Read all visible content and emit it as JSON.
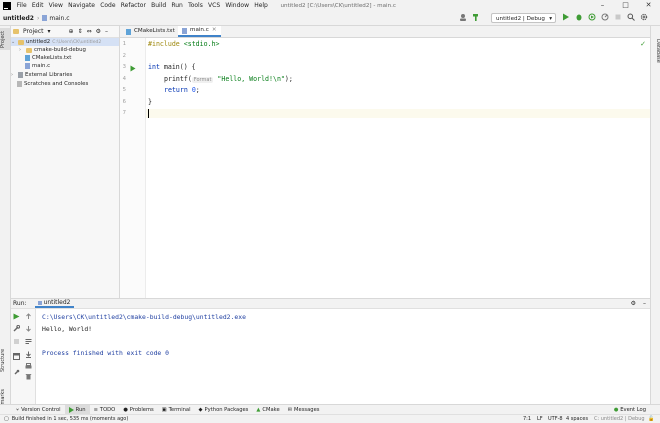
{
  "menubar": {
    "items": [
      "File",
      "Edit",
      "View",
      "Navigate",
      "Code",
      "Refactor",
      "Build",
      "Run",
      "Tools",
      "VCS",
      "Window",
      "Help"
    ],
    "window_title": "untitled2 [C:\\Users\\CK\\untitled2] - main.c"
  },
  "navbar": {
    "project": "untitled2",
    "file": "main.c",
    "run_config": "untitled2 | Debug"
  },
  "side_tabs": {
    "project": "Project",
    "structure": "Structure",
    "bookmarks": "Bookmarks",
    "database": "Database"
  },
  "project_panel": {
    "title": "Project",
    "tree": [
      {
        "label": "untitled2",
        "hint": "C:\\Users\\CK\\untitled2"
      },
      {
        "label": "cmake-build-debug"
      },
      {
        "label": "CMakeLists.txt"
      },
      {
        "label": "main.c"
      },
      {
        "label": "External Libraries"
      },
      {
        "label": "Scratches and Consoles"
      }
    ]
  },
  "editor": {
    "tabs": [
      "CMakeLists.txt",
      "main.c"
    ],
    "line_numbers": [
      "1",
      "2",
      "3",
      "4",
      "5",
      "6",
      "7"
    ],
    "code": {
      "l1_directive": "#include",
      "l1_header": "<stdio.h>",
      "l3_type": "int",
      "l3_rest": " main() {",
      "l4_call": "printf(",
      "l4_hint": "Format",
      "l4_string": "\"Hello, World!\\n\"",
      "l4_end": ");",
      "l5_kw": "return",
      "l5_num": "0",
      "l5_end": ";",
      "l6": "}"
    }
  },
  "run_panel": {
    "label": "Run:",
    "tab": "untitled2",
    "output": [
      "C:\\Users\\CK\\untitled2\\cmake-build-debug\\untitled2.exe",
      "Hello, World!",
      "",
      "Process finished with exit code 0"
    ]
  },
  "tool_windows": [
    "Version Control",
    "Run",
    "TODO",
    "Problems",
    "Terminal",
    "Python Packages",
    "CMake",
    "Messages"
  ],
  "event_log": "Event Log",
  "status": {
    "message": "Build finished in 1 sec, 535 ms (moments ago)",
    "position": "7:1",
    "line_sep": "LF",
    "encoding": "UTF-8",
    "indent": "4 spaces",
    "context": "C: untitled2 | Debug"
  },
  "colors": {
    "accent": "#4083c9",
    "run_green": "#3f9c35",
    "keyword": "#0033b3",
    "string": "#067d17"
  }
}
